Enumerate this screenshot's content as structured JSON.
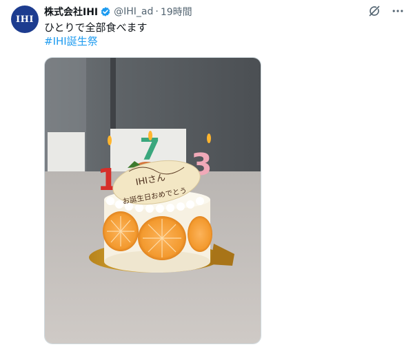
{
  "account": {
    "display_name": "株式会社IHI",
    "handle": "@IHI_ad",
    "separator": "·",
    "timestamp": "19時間",
    "avatar_text": "IHI",
    "verified": true
  },
  "tweet": {
    "text": "ひとりで全部食べます",
    "hashtag": "#IHI誕生祭"
  },
  "photo": {
    "candles": [
      "1",
      "7",
      "3"
    ],
    "plaque_line1": "IHIさん",
    "plaque_line2": "お誕生日おめでとう"
  },
  "icons": {
    "verified": "verified-badge-icon",
    "grok": "grok-icon",
    "more": "more-icon"
  },
  "colors": {
    "link": "#1d9bf0",
    "secondary_text": "#536471",
    "avatar_bg": "#1d3c8f"
  }
}
